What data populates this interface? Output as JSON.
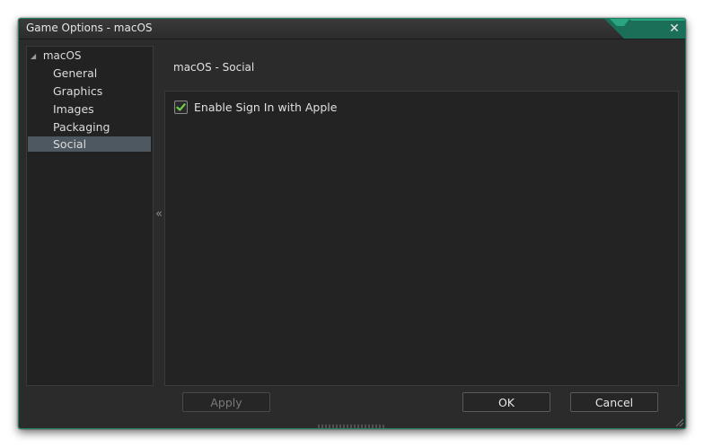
{
  "window": {
    "title": "Game Options - macOS",
    "accent_color": "#1e8a6a"
  },
  "tree": {
    "root": "macOS",
    "items": [
      {
        "label": "General",
        "selected": false
      },
      {
        "label": "Graphics",
        "selected": false
      },
      {
        "label": "Images",
        "selected": false
      },
      {
        "label": "Packaging",
        "selected": false
      },
      {
        "label": "Social",
        "selected": true
      }
    ]
  },
  "collapse_glyph": "«",
  "content": {
    "section_title": "macOS - Social",
    "options": [
      {
        "label": "Enable Sign In with Apple",
        "checked": true
      }
    ]
  },
  "buttons": {
    "apply": "Apply",
    "ok": "OK",
    "cancel": "Cancel"
  },
  "colors": {
    "check_green": "#6fd14a",
    "selection": "#4d5860"
  }
}
